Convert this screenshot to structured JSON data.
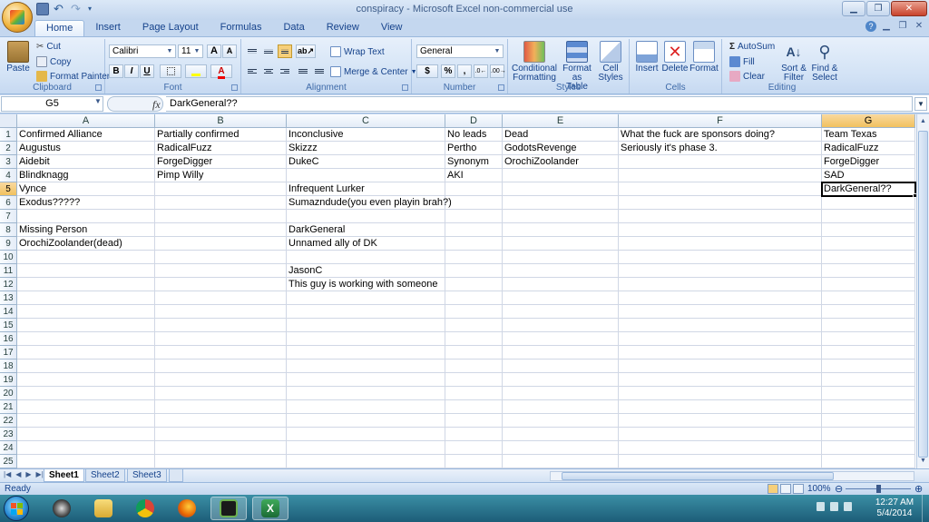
{
  "window": {
    "title": "conspiracy - Microsoft Excel non-commercial use"
  },
  "ribbon_tabs": [
    "Home",
    "Insert",
    "Page Layout",
    "Formulas",
    "Data",
    "Review",
    "View"
  ],
  "ribbon": {
    "clipboard": {
      "title": "Clipboard",
      "paste": "Paste",
      "cut": "Cut",
      "copy": "Copy",
      "format_painter": "Format Painter"
    },
    "font": {
      "title": "Font",
      "name": "Calibri",
      "size": "11",
      "grow": "A",
      "shrink": "A",
      "bold": "B",
      "italic": "I",
      "underline": "U"
    },
    "alignment": {
      "title": "Alignment",
      "wrap_text": "Wrap Text",
      "merge_center": "Merge & Center"
    },
    "number": {
      "title": "Number",
      "format": "General",
      "currency": "$",
      "percent": "%",
      "comma": ","
    },
    "styles": {
      "title": "Styles",
      "conditional_line1": "Conditional",
      "conditional_line2": "Formatting",
      "table_line1": "Format",
      "table_line2": "as Table",
      "cell_line1": "Cell",
      "cell_line2": "Styles"
    },
    "cells": {
      "title": "Cells",
      "insert": "Insert",
      "delete": "Delete",
      "format": "Format"
    },
    "editing": {
      "title": "Editing",
      "autosum": "AutoSum",
      "fill": "Fill",
      "clear": "Clear",
      "sort_line1": "Sort &",
      "sort_line2": "Filter",
      "find_line1": "Find &",
      "find_line2": "Select"
    }
  },
  "formula_bar": {
    "name_box": "G5",
    "fx": "fx",
    "content": "DarkGeneral??"
  },
  "columns": [
    "A",
    "B",
    "C",
    "D",
    "E",
    "F",
    "G"
  ],
  "rows": [
    "1",
    "2",
    "3",
    "4",
    "5",
    "6",
    "7",
    "8",
    "9",
    "10",
    "11",
    "12",
    "13",
    "14",
    "15",
    "16",
    "17",
    "18",
    "19",
    "20",
    "21",
    "22",
    "23",
    "24",
    "25"
  ],
  "cells": {
    "A1": "Confirmed Alliance",
    "B1": "Partially confirmed",
    "C1": "Inconclusive",
    "D1": "No leads",
    "E1": "Dead",
    "F1": "What the fuck are sponsors doing?",
    "G1": "Team Texas",
    "A2": "Augustus",
    "B2": "RadicalFuzz",
    "C2": "Skizzz",
    "D2": "Pertho",
    "E2": "GodotsRevenge",
    "F2": "Seriously it's phase 3.",
    "G2": "RadicalFuzz",
    "A3": "Aidebit",
    "B3": "ForgeDigger",
    "C3": "DukeC",
    "D3": "Synonym",
    "E3": "OrochiZoolander",
    "G3": "ForgeDigger",
    "A4": "Blindknagg",
    "B4": "Pimp Willy",
    "D4": "AKI",
    "G4": "SAD",
    "A5": "Vynce",
    "C5": "Infrequent Lurker",
    "G5": "DarkGeneral??",
    "A6": "Exodus?????",
    "C6": "Sumazndude(you even playin brah?)",
    "A8": "Missing Person",
    "C8": "DarkGeneral",
    "A9": "OrochiZoolander(dead)",
    "C9": "Unnamed ally of DK",
    "C11": "JasonC",
    "C12": "This guy is working with someone"
  },
  "selected_cell": "G5",
  "sheets": [
    "Sheet1",
    "Sheet2",
    "Sheet3"
  ],
  "active_sheet": "Sheet1",
  "status": {
    "text": "Ready",
    "zoom": "100%"
  },
  "taskbar": {
    "time": "12:27 AM",
    "date": "5/4/2014"
  }
}
